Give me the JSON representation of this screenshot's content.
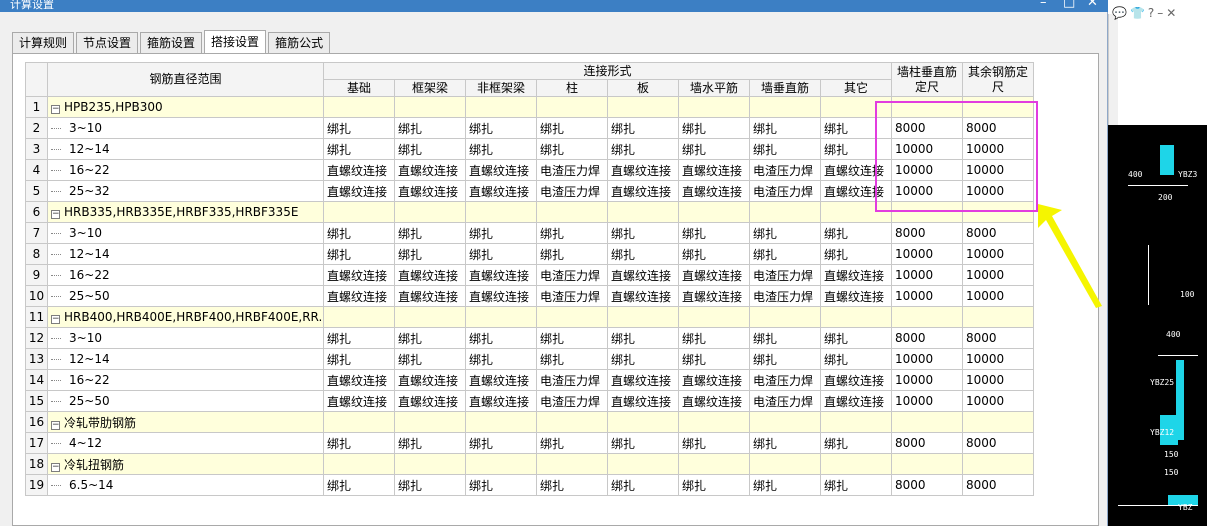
{
  "window": {
    "title": "计算设置",
    "min_glyph": "–",
    "max_glyph": "□",
    "close_glyph": "✕"
  },
  "tabs": [
    {
      "label": "计算规则",
      "active": false
    },
    {
      "label": "节点设置",
      "active": false
    },
    {
      "label": "箍筋设置",
      "active": false
    },
    {
      "label": "搭接设置",
      "active": true
    },
    {
      "label": "箍筋公式",
      "active": false
    }
  ],
  "table": {
    "header_range": "钢筋直径范围",
    "header_group": "连接形式",
    "sub_headers": [
      "基础",
      "框架梁",
      "非框架梁",
      "柱",
      "板",
      "墙水平筋",
      "墙垂直筋",
      "其它"
    ],
    "header_wall": "墙柱垂直筋定尺",
    "header_other": "其余钢筋定尺",
    "rows": [
      {
        "num": "1",
        "group": true,
        "label": "HPB235,HPB300"
      },
      {
        "num": "2",
        "label": "3~10",
        "cells": [
          "绑扎",
          "绑扎",
          "绑扎",
          "绑扎",
          "绑扎",
          "绑扎",
          "绑扎",
          "绑扎"
        ],
        "wall": "8000",
        "other": "8000"
      },
      {
        "num": "3",
        "label": "12~14",
        "cells": [
          "绑扎",
          "绑扎",
          "绑扎",
          "绑扎",
          "绑扎",
          "绑扎",
          "绑扎",
          "绑扎"
        ],
        "wall": "10000",
        "other": "10000"
      },
      {
        "num": "4",
        "label": "16~22",
        "cells": [
          "直螺纹连接",
          "直螺纹连接",
          "直螺纹连接",
          "电渣压力焊",
          "直螺纹连接",
          "直螺纹连接",
          "电渣压力焊",
          "直螺纹连接"
        ],
        "wall": "10000",
        "other": "10000"
      },
      {
        "num": "5",
        "label": "25~32",
        "cells": [
          "直螺纹连接",
          "直螺纹连接",
          "直螺纹连接",
          "电渣压力焊",
          "直螺纹连接",
          "直螺纹连接",
          "电渣压力焊",
          "直螺纹连接"
        ],
        "wall": "10000",
        "other": "10000"
      },
      {
        "num": "6",
        "group": true,
        "label": "HRB335,HRB335E,HRBF335,HRBF335E"
      },
      {
        "num": "7",
        "label": "3~10",
        "cells": [
          "绑扎",
          "绑扎",
          "绑扎",
          "绑扎",
          "绑扎",
          "绑扎",
          "绑扎",
          "绑扎"
        ],
        "wall": "8000",
        "other": "8000"
      },
      {
        "num": "8",
        "label": "12~14",
        "cells": [
          "绑扎",
          "绑扎",
          "绑扎",
          "绑扎",
          "绑扎",
          "绑扎",
          "绑扎",
          "绑扎"
        ],
        "wall": "10000",
        "other": "10000"
      },
      {
        "num": "9",
        "label": "16~22",
        "cells": [
          "直螺纹连接",
          "直螺纹连接",
          "直螺纹连接",
          "电渣压力焊",
          "直螺纹连接",
          "直螺纹连接",
          "电渣压力焊",
          "直螺纹连接"
        ],
        "wall": "10000",
        "other": "10000"
      },
      {
        "num": "10",
        "label": "25~50",
        "cells": [
          "直螺纹连接",
          "直螺纹连接",
          "直螺纹连接",
          "电渣压力焊",
          "直螺纹连接",
          "直螺纹连接",
          "电渣压力焊",
          "直螺纹连接"
        ],
        "wall": "10000",
        "other": "10000"
      },
      {
        "num": "11",
        "group": true,
        "label": "HRB400,HRB400E,HRBF400,HRBF400E,RR..."
      },
      {
        "num": "12",
        "label": "3~10",
        "cells": [
          "绑扎",
          "绑扎",
          "绑扎",
          "绑扎",
          "绑扎",
          "绑扎",
          "绑扎",
          "绑扎"
        ],
        "wall": "8000",
        "other": "8000"
      },
      {
        "num": "13",
        "label": "12~14",
        "cells": [
          "绑扎",
          "绑扎",
          "绑扎",
          "绑扎",
          "绑扎",
          "绑扎",
          "绑扎",
          "绑扎"
        ],
        "wall": "10000",
        "other": "10000"
      },
      {
        "num": "14",
        "label": "16~22",
        "cells": [
          "直螺纹连接",
          "直螺纹连接",
          "直螺纹连接",
          "电渣压力焊",
          "直螺纹连接",
          "直螺纹连接",
          "电渣压力焊",
          "直螺纹连接"
        ],
        "wall": "10000",
        "other": "10000"
      },
      {
        "num": "15",
        "label": "25~50",
        "cells": [
          "直螺纹连接",
          "直螺纹连接",
          "直螺纹连接",
          "电渣压力焊",
          "直螺纹连接",
          "直螺纹连接",
          "电渣压力焊",
          "直螺纹连接"
        ],
        "wall": "10000",
        "other": "10000"
      },
      {
        "num": "16",
        "group": true,
        "label": "冷轧带肋钢筋"
      },
      {
        "num": "17",
        "label": "4~12",
        "cells": [
          "绑扎",
          "绑扎",
          "绑扎",
          "绑扎",
          "绑扎",
          "绑扎",
          "绑扎",
          "绑扎"
        ],
        "wall": "8000",
        "other": "8000"
      },
      {
        "num": "18",
        "group": true,
        "label": "冷轧扭钢筋"
      },
      {
        "num": "19",
        "label": "6.5~14",
        "cells": [
          "绑扎",
          "绑扎",
          "绑扎",
          "绑扎",
          "绑扎",
          "绑扎",
          "绑扎",
          "绑扎"
        ],
        "wall": "8000",
        "other": "8000"
      }
    ]
  },
  "background_app": {
    "icons": [
      "comment-icon",
      "shirt-icon",
      "help-icon",
      "minimize-icon",
      "close-icon"
    ],
    "cad_labels": [
      "YBZ3",
      "400",
      "200",
      "100",
      "400",
      "YBZ25",
      "YBZ12",
      "150",
      "150",
      "YBZ"
    ]
  },
  "colors": {
    "highlight": "#e23cdf",
    "arrow": "#f5f500",
    "group_row": "#ffffdc",
    "title_bar": "#3c7fc4",
    "cad_cyan": "#1ed5e8"
  }
}
